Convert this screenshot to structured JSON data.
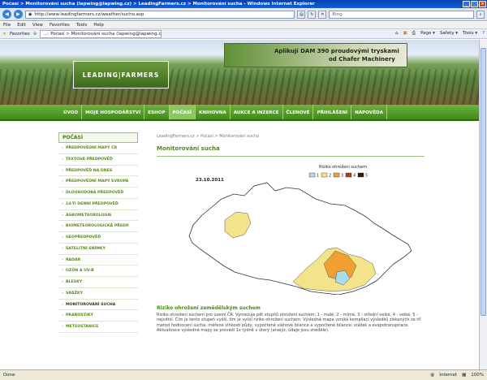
{
  "browser": {
    "title": "Počasí > Monitorování sucha (lapwing@lapwing.cz) > LeadingFarmers.cz > Monitorování sucha - Windows Internet Explorer",
    "url": "http://www.leadingfarmers.cz/weather/sucho.asp",
    "search_placeholder": "Bing",
    "menu": [
      "File",
      "Edit",
      "View",
      "Favorites",
      "Tools",
      "Help"
    ],
    "favorites_label": "Favorites",
    "tab_label": "...: Počasí > Monitorování sucha (lapwing@lapwing.cz...",
    "tools": [
      "Page ▾",
      "Safety ▾",
      "Tools ▾"
    ],
    "status_left": "Done",
    "status_zone": "Internet",
    "zoom": "100%"
  },
  "site": {
    "logo_text": "LEADING|FARMERS",
    "ad_line1": "Aplikují DAM 390 proudovými tryskami",
    "ad_line2": "od Chafer Machinery",
    "nav": [
      "ÚVOD",
      "MOJE HOSPODÁŘSTVÍ",
      "ESHOP",
      "POČASÍ",
      "KNIHOVNA",
      "AUKCE A INZERCE",
      "ČLENOVÉ",
      "PŘIHLÁŠENÍ",
      "NÁPOVĚDA"
    ],
    "active_nav": "POČASÍ"
  },
  "sidebar": {
    "title": "POČASÍ",
    "items": [
      "PŘEDPOVĚDNÍ MAPY ČR",
      "TEXTOVÁ PŘEDPOVĚĎ",
      "PŘEDPOVĚĎ NA DNES",
      "PŘEDPOVĚDNÍ MAPY EVROPA",
      "DLOUHODOBÁ PŘEDPOVĚĎ",
      "14-TI DENNÍ PŘEDPOVĚĎ",
      "AGROMETEOROLOGIE",
      "BIOMETEOROLOGICKÁ PŘEDP.",
      "GEOPŘEDPOVĚĎ",
      "SATELITNÍ SNÍMKY",
      "RADAR",
      "OZÓN A UV-B",
      "BLESKY",
      "SRÁŽKY",
      "MONITOROVÁNÍ SUCHA",
      "PRANOSTIKY",
      "METEOSTANICE"
    ],
    "current": "MONITOROVÁNÍ SUCHA"
  },
  "main": {
    "breadcrumb": "LeadingFarmers.cz > Počasí > Monitorování sucha",
    "title": "Monitorování sucha",
    "map": {
      "date": "23.10.2011",
      "legend_title": "Riziko ohrožení suchem",
      "legend": [
        {
          "label": "1",
          "color": "#a8dcf0"
        },
        {
          "label": "2",
          "color": "#f3e38a"
        },
        {
          "label": "3",
          "color": "#f0a030"
        },
        {
          "label": "4",
          "color": "#b04010"
        },
        {
          "label": "5",
          "color": "#3a1808"
        }
      ]
    },
    "section_title": "Riziko ohrožení zemědělským suchem",
    "description": "Riziko ohrožení suchem pro území ČR. Vymezuje pět stupňů ohrožení suchem: 1 - malé, 2 - mírné, 3 - střední velké, 4 - velké, 5 - největší. Čím je tento stupeň vyšší, tím je vyšší riziko ohrožení suchem. Výsledná mapa vzniká kompilací výsledků získaných ze tří metod hodnocení sucha: měřené vlhkosti půdy, vypočtené vláhové bilance a vypočtené bilance: srážek a evapotranspirace. Aktualizace výsledné mapy se provádí 1x týdně v úterý (analýz, údaje jsou zneděle)."
  }
}
